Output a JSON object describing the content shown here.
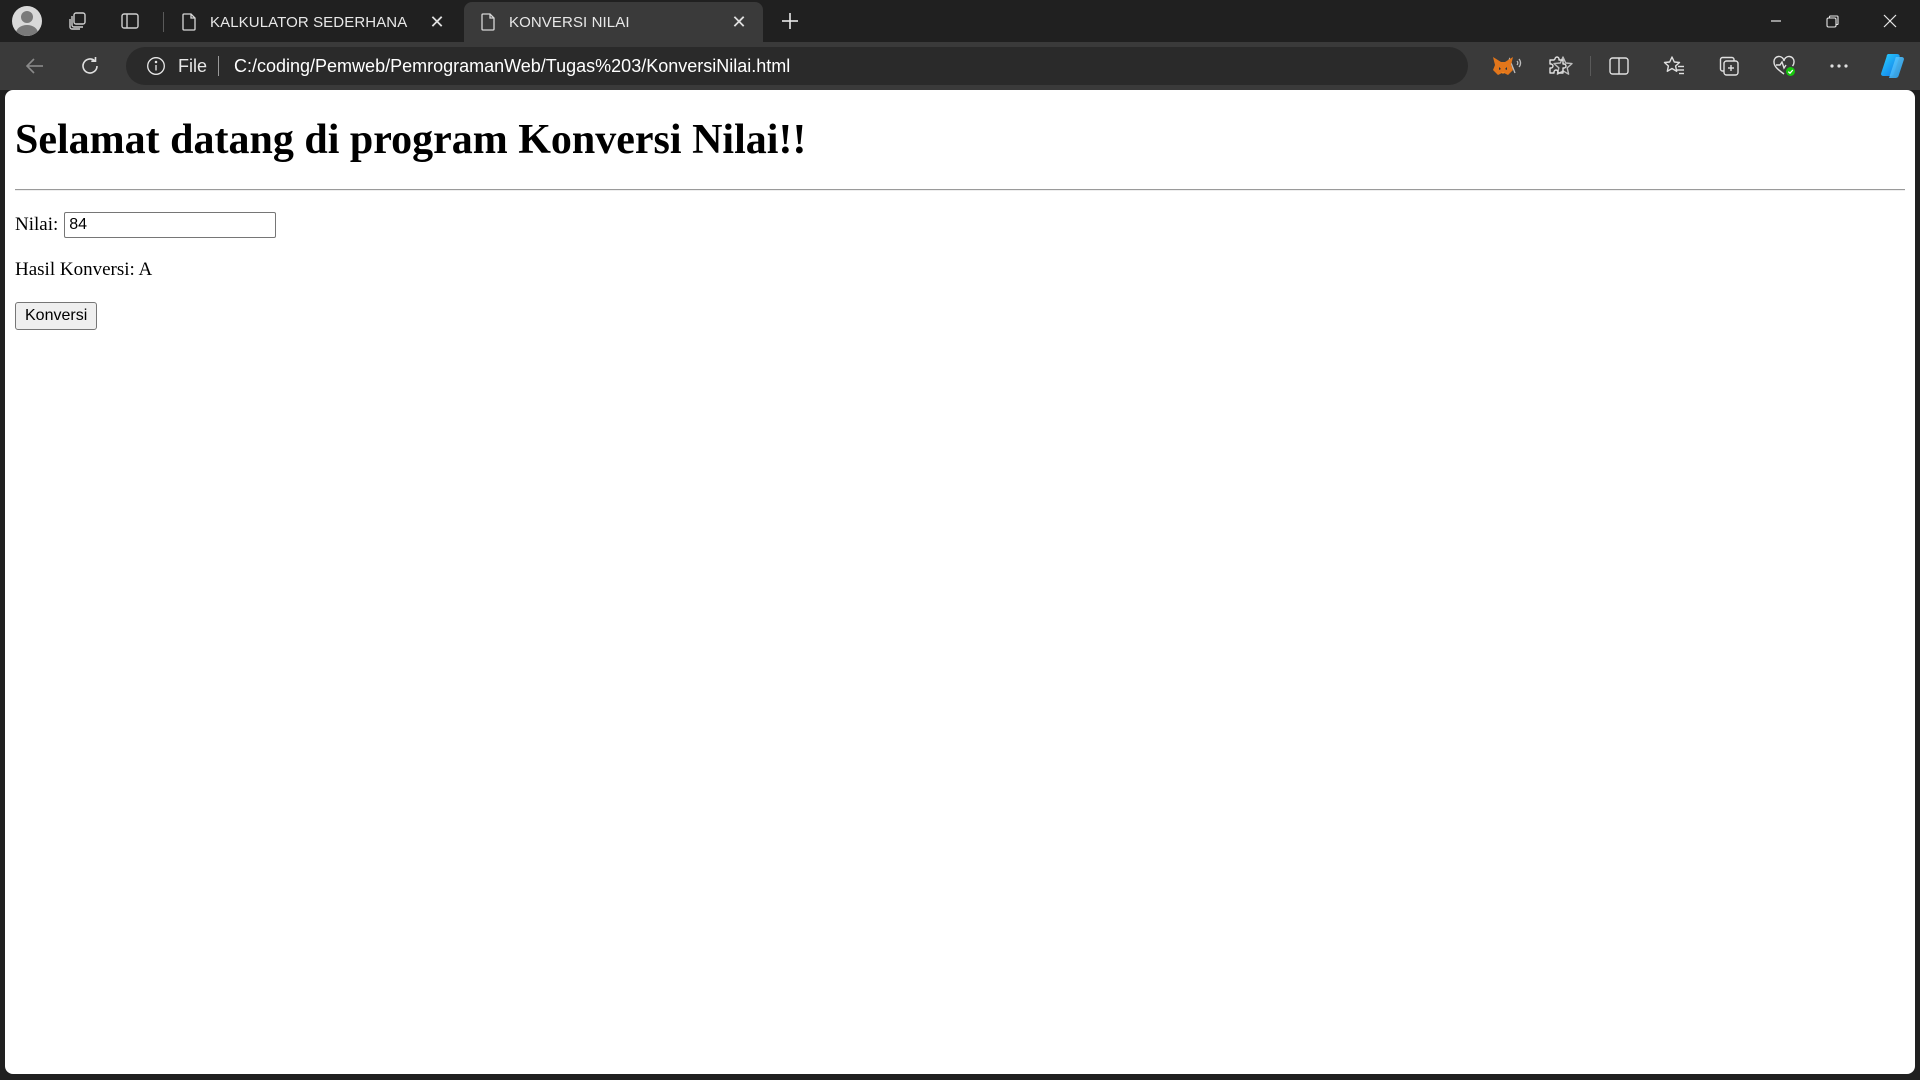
{
  "browser": {
    "tabs": [
      {
        "title": "KALKULATOR SEDERHANA",
        "active": false,
        "icon": "document-icon"
      },
      {
        "title": "KONVERSI NILAI",
        "active": true,
        "icon": "document-icon"
      }
    ],
    "address": {
      "scheme_label": "File",
      "url": "C:/coding/Pemweb/PemrogramanWeb/Tugas%203/KonversiNilai.html"
    },
    "toolbar_icons": [
      "back-icon",
      "reload-icon",
      "read-aloud-icon",
      "favorite-star-icon",
      "metamask-icon",
      "extensions-icon",
      "split-screen-icon",
      "favorites-icon",
      "collections-icon",
      "browser-essentials-icon",
      "more-icon",
      "copilot-icon"
    ],
    "read_aloud_glyph": "A⁾"
  },
  "page": {
    "heading": "Selamat datang di program Konversi Nilai!!",
    "nilai_label": "Nilai:",
    "nilai_value": "84",
    "hasil_label": "Hasil Konversi:",
    "hasil_value": "A",
    "button_label": "Konversi"
  },
  "colors": {
    "frame": "#202020",
    "toolbar": "#3a3a3a",
    "address_bar": "#2a2a2a",
    "page_background": "#ffffff",
    "copilot_accent": "#1e9bf0"
  }
}
